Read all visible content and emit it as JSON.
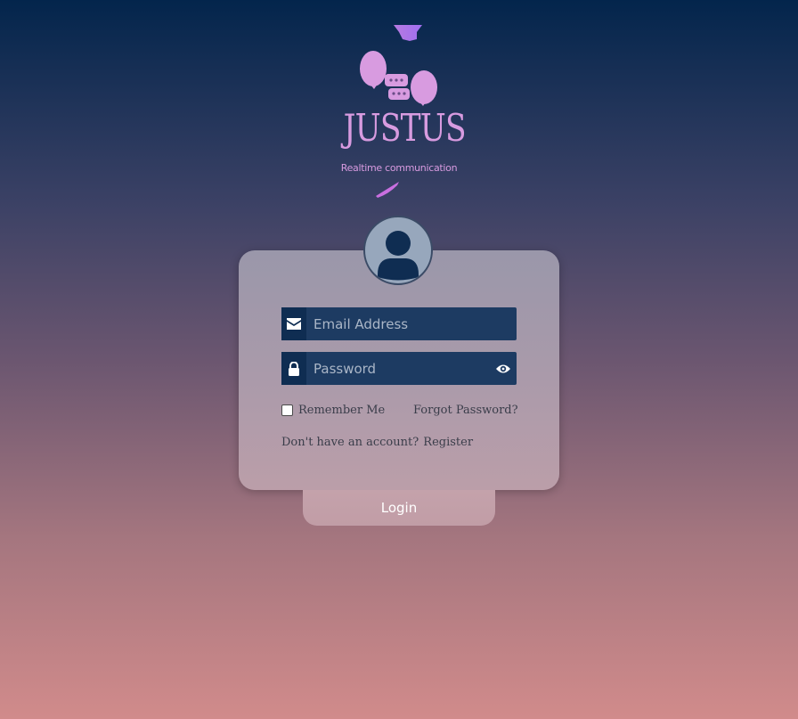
{
  "logo": {
    "title": "JUSTUS",
    "subtitle": "Realtime communication"
  },
  "form": {
    "email_placeholder": "Email Address",
    "password_placeholder": "Password",
    "remember_label": "Remember Me",
    "forgot_label": "Forgot Password?",
    "register_prompt": "Don't have an account?",
    "register_link": "Register"
  },
  "login_button": {
    "label": "Login"
  },
  "icons": {
    "email": "envelope-icon",
    "password": "lock-icon",
    "toggle": "eye-icon",
    "avatar": "user-avatar-icon"
  },
  "colors": {
    "logo": "#d89be0",
    "field_bg": "#1d3b62",
    "field_icon_bg": "#0f2d52"
  }
}
